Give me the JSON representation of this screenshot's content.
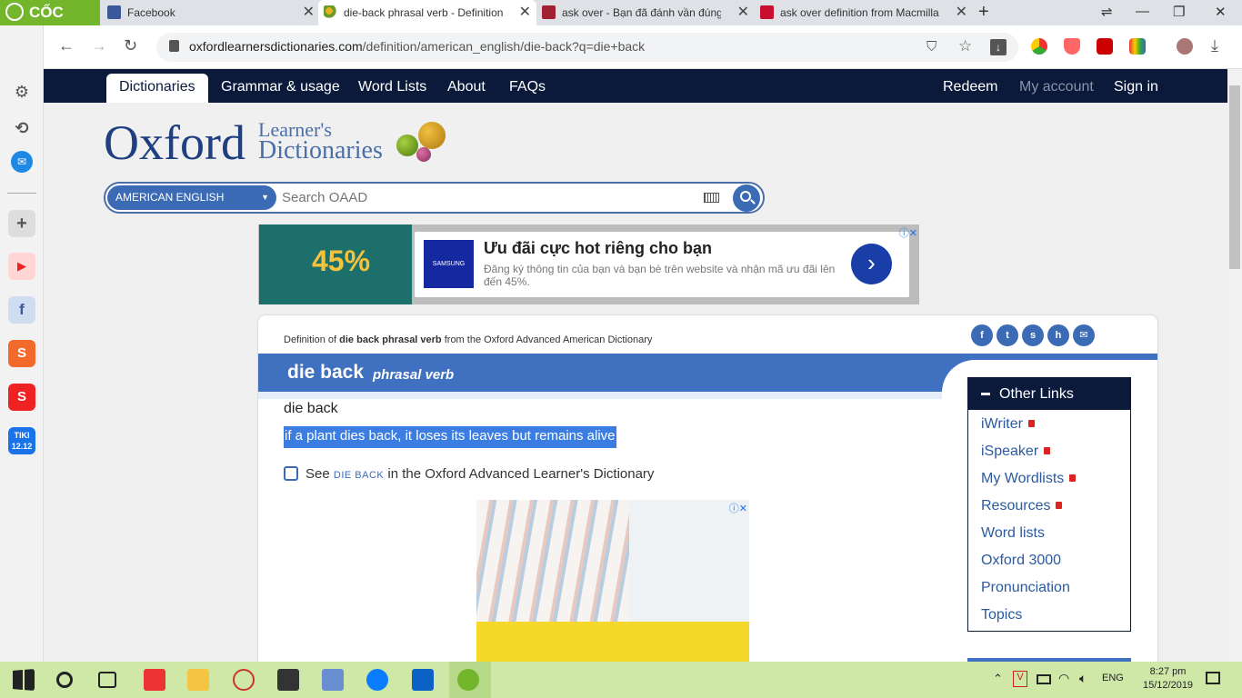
{
  "browser": {
    "brand": "CỐC CỐC",
    "tabs": [
      {
        "title": "Facebook",
        "icon": "facebook-icon",
        "active": false
      },
      {
        "title": "die-back phrasal verb - Definition, pictures, pronunciation",
        "icon": "oxford-favicon-icon",
        "active": true
      },
      {
        "title": "ask over - Bạn đã đánh vần đúng chưa?",
        "icon": "cambridge-favicon-icon",
        "active": false
      },
      {
        "title": "ask over definition from Macmillan Dictionary",
        "icon": "macmillan-favicon-icon",
        "active": false
      }
    ],
    "url_host": "oxfordlearnersdictionaries.com",
    "url_path": "/definition/american_english/die-back?q=die+back"
  },
  "site": {
    "nav": {
      "dictionaries": "Dictionaries",
      "grammar": "Grammar & usage",
      "word_lists": "Word Lists",
      "about": "About",
      "faqs": "FAQs",
      "redeem": "Redeem",
      "my_account": "My account",
      "sign_in": "Sign in"
    },
    "logo": {
      "word": "Oxford",
      "line1": "Learner's",
      "line2": "Dictionaries"
    },
    "search": {
      "language": "AMERICAN ENGLISH",
      "placeholder": "Search OAAD"
    }
  },
  "ad_banner": {
    "left_percent": "45%",
    "title": "Ưu đãi cực hot riêng cho bạn",
    "description": "Đăng ký thông tin của bạn và bạn bè trên website và nhận mã ưu đãi lên đến 45%.",
    "brand": "SAMSUNG"
  },
  "entry": {
    "crumb_prefix": "Definition of",
    "crumb_bold": "die back phrasal verb",
    "crumb_suffix": "from the Oxford Advanced American Dictionary",
    "headword": "die back",
    "pos": "phrasal verb",
    "sense_headword": "die back",
    "definition": "if a plant dies back, it loses its leaves but remains alive",
    "see_prefix": "See",
    "see_link": "DIE BACK",
    "see_suffix": "in the Oxford Advanced Learner's Dictionary"
  },
  "other_links": {
    "title": "Other Links",
    "items": [
      "iWriter",
      "iSpeaker",
      "My Wordlists",
      "Resources",
      "Word lists",
      "Oxford 3000",
      "Pronunciation",
      "Topics"
    ]
  },
  "taskbar": {
    "lang": "ENG",
    "time": "8:27 pm",
    "date": "15/12/2019"
  },
  "colors": {
    "nav_bg": "#0b1a3b",
    "accent": "#4070c0",
    "highlight": "#3b7de0",
    "taskbar": "#cfe8a8"
  }
}
